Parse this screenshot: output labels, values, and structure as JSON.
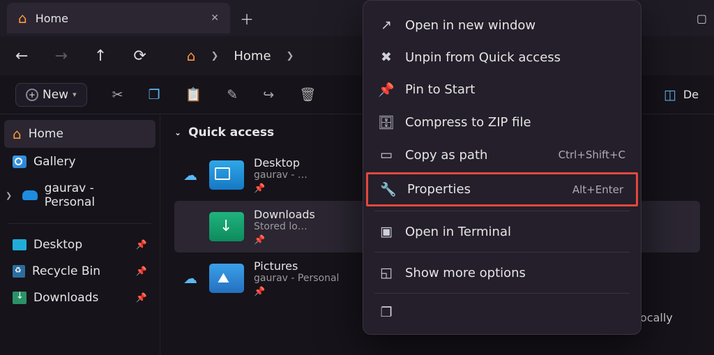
{
  "tab": {
    "title": "Home"
  },
  "breadcrumb": {
    "current": "Home"
  },
  "toolbar": {
    "new_label": "New",
    "details_label": "De"
  },
  "sidebar": {
    "home": "Home",
    "gallery": "Gallery",
    "cloud": "gaurav - Personal",
    "desktop": "Desktop",
    "recycle": "Recycle Bin",
    "downloads": "Downloads"
  },
  "section": {
    "title": "Quick access"
  },
  "folders": [
    {
      "name": "Desktop",
      "sub": "gaurav - …",
      "cloud": true
    },
    {
      "name": "Downloads",
      "sub": "Stored lo…",
      "cloud": false,
      "selected": true
    },
    {
      "name": "Pictures",
      "sub": "gaurav - Personal",
      "cloud": true
    }
  ],
  "music": {
    "stored": "Stored locally"
  },
  "ctx": {
    "open_new": "Open in new window",
    "unpin": "Unpin from Quick access",
    "pin_start": "Pin to Start",
    "compress": "Compress to ZIP file",
    "copy_path": "Copy as path",
    "copy_path_kbd": "Ctrl+Shift+C",
    "properties": "Properties",
    "properties_kbd": "Alt+Enter",
    "terminal": "Open in Terminal",
    "more": "Show more options"
  }
}
